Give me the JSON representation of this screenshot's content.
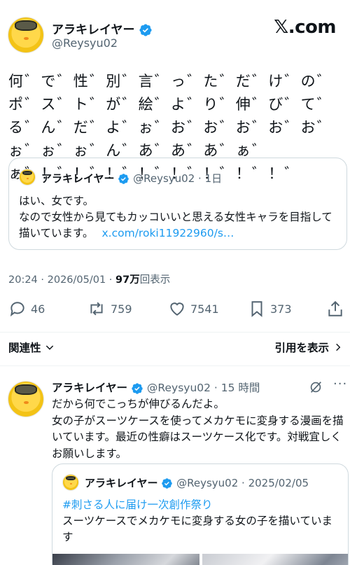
{
  "author": {
    "name": "アラキレイヤー",
    "handle": "@Reysyu02",
    "verified": true
  },
  "brand": "𝕏.com",
  "post": {
    "text": "何゛で゛性゛別゛言゛っ゛た゛だ゛け゛の゛ポ゛ス゛ト゛が゛絵゛よ゛り゛伸゛び゛て゛る゛ん゛だ゛よ゛ぉ゛お゛お゛お゛お゛お゛ぉ゛ぉ゛ぉ゛ん゛あ゛あ゛あ゛ぁ゛ぁ゛！゛！゛！゛！゛！゛！゛！゛！゛"
  },
  "quote": {
    "name": "アラキレイヤー",
    "handle": "@Reysyu02",
    "time": "1日",
    "line1": "はい、女です。",
    "line2": "なので女性から見てもカッコいいと思える女性キャラを目指して描いています。",
    "link": "x.com/roki11922960/s…"
  },
  "meta": {
    "time": "20:24",
    "date": "2026/05/01",
    "views": "97万",
    "views_label": "回表示"
  },
  "actions": {
    "replies": "46",
    "reposts": "759",
    "likes": "7541",
    "bookmarks": "373"
  },
  "related_label": "関連性",
  "quotes_label": "引用を表示",
  "reply": {
    "name": "アラキレイヤー",
    "handle": "@Reysyu02",
    "time": "15 時間",
    "line1": "だから何でこっちが伸びるんだよ。",
    "line2": "女の子がスーツケースを使ってメカケモに変身する漫画を描いています。最近の性癖はスーツケース化です。対戦宜しくお願いします。",
    "quote": {
      "name": "アラキレイヤー",
      "handle": "@Reysyu02",
      "date": "2025/02/05",
      "hashtag": "#刺さる人に届け一次創作祭り",
      "text": "スーツケースでメカケモに変身する女の子を描いています"
    }
  },
  "colors": {
    "accent": "#1d9bf0",
    "muted": "#536471",
    "text": "#0f1419",
    "border": "#cfd9de"
  }
}
